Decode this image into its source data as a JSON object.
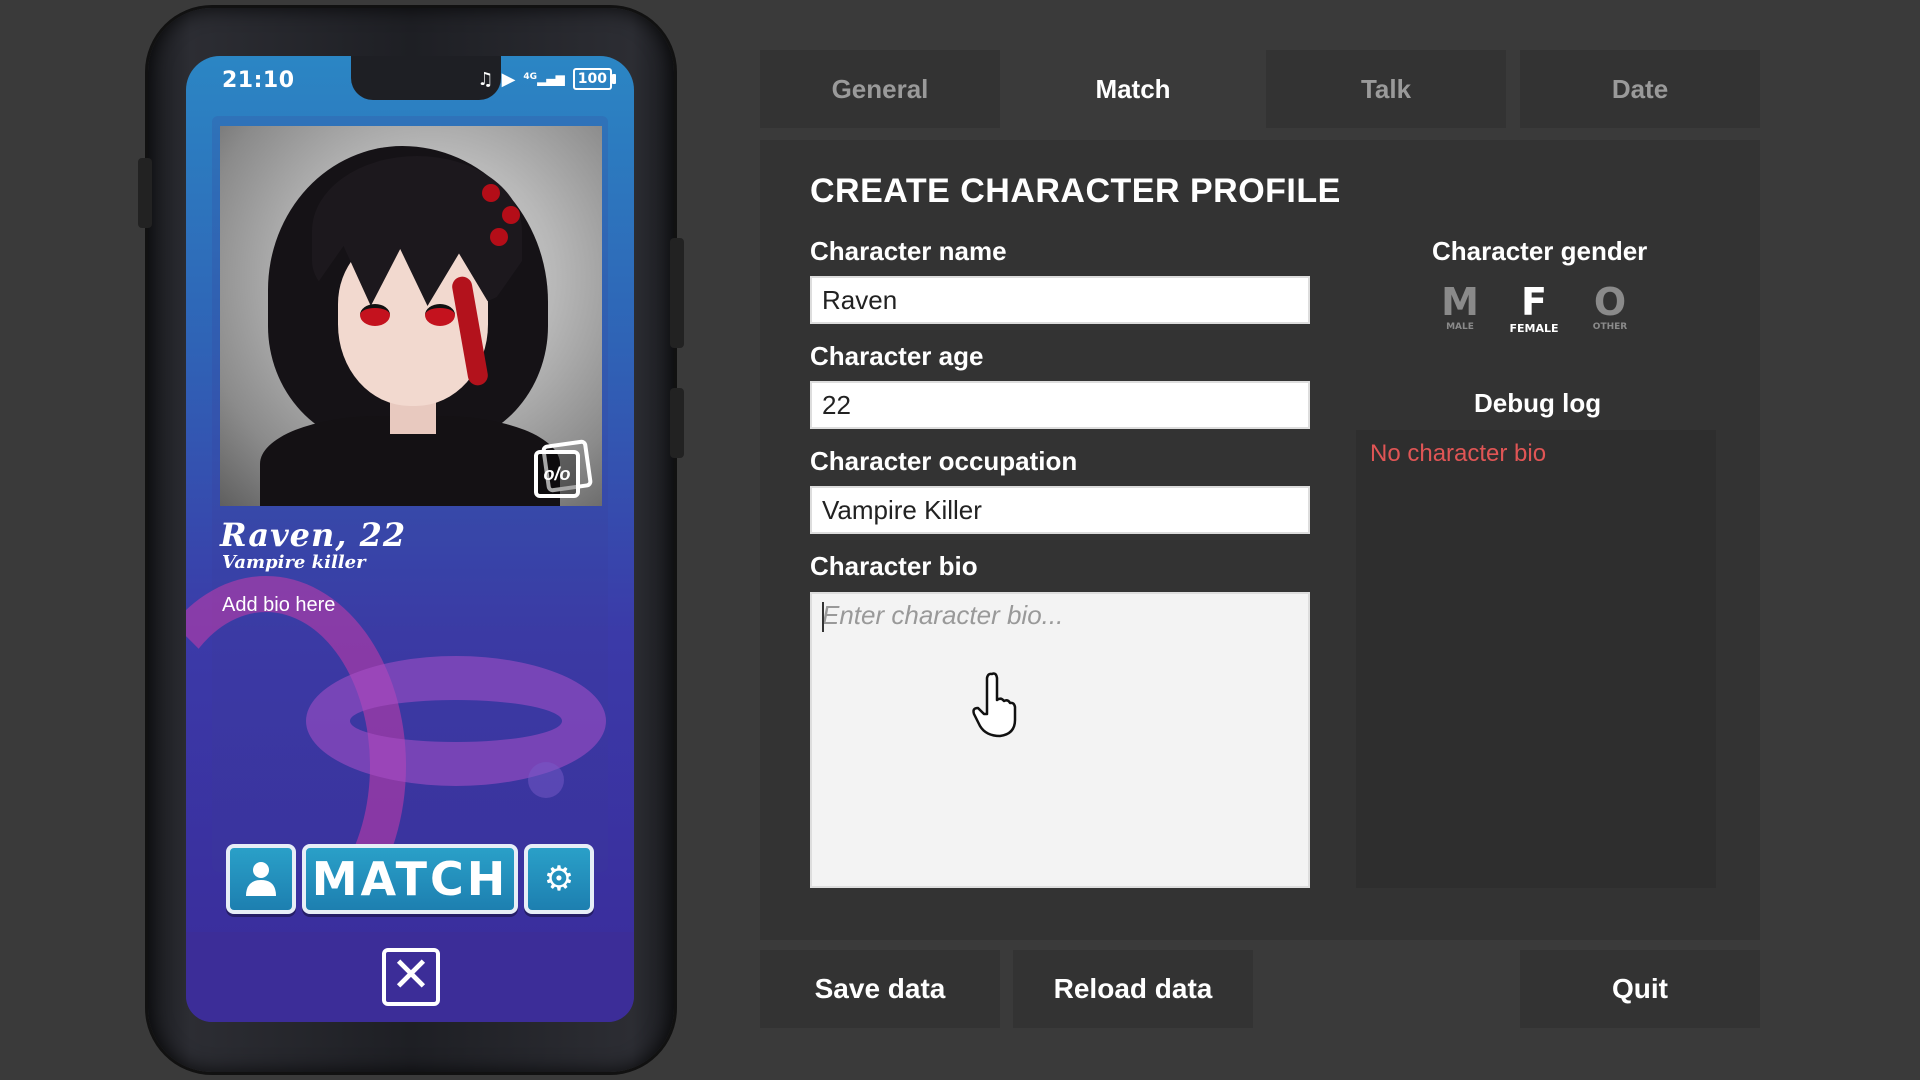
{
  "phone": {
    "status": {
      "time": "21:10",
      "network": "4G",
      "battery": "100"
    },
    "profile": {
      "name_age": "Raven, 22",
      "occupation": "Vampire killer",
      "bio": "Add bio here"
    },
    "buttons": {
      "match_label": "MATCH"
    },
    "gallery_label": "o/o"
  },
  "tabs": [
    {
      "label": "General",
      "active": false
    },
    {
      "label": "Match",
      "active": true
    },
    {
      "label": "Talk",
      "active": false
    },
    {
      "label": "Date",
      "active": false
    }
  ],
  "form": {
    "heading": "CREATE CHARACTER PROFILE",
    "name": {
      "label": "Character name",
      "value": "Raven"
    },
    "age": {
      "label": "Character age",
      "value": "22"
    },
    "occupation": {
      "label": "Character occupation",
      "value": "Vampire Killer"
    },
    "bio": {
      "label": "Character bio",
      "placeholder": "Enter character bio..."
    }
  },
  "gender": {
    "label": "Character gender",
    "options": [
      {
        "letter": "M",
        "caption": "MALE",
        "selected": false
      },
      {
        "letter": "F",
        "caption": "FEMALE",
        "selected": true
      },
      {
        "letter": "O",
        "caption": "OTHER",
        "selected": false
      }
    ]
  },
  "debug": {
    "label": "Debug log",
    "message": "No character bio"
  },
  "actions": {
    "save": "Save data",
    "reload": "Reload data",
    "quit": "Quit"
  },
  "colors": {
    "background": "#3a3a3a",
    "panel": "#333333",
    "debug_text": "#e05555",
    "match_button": "#1d7fb0"
  }
}
